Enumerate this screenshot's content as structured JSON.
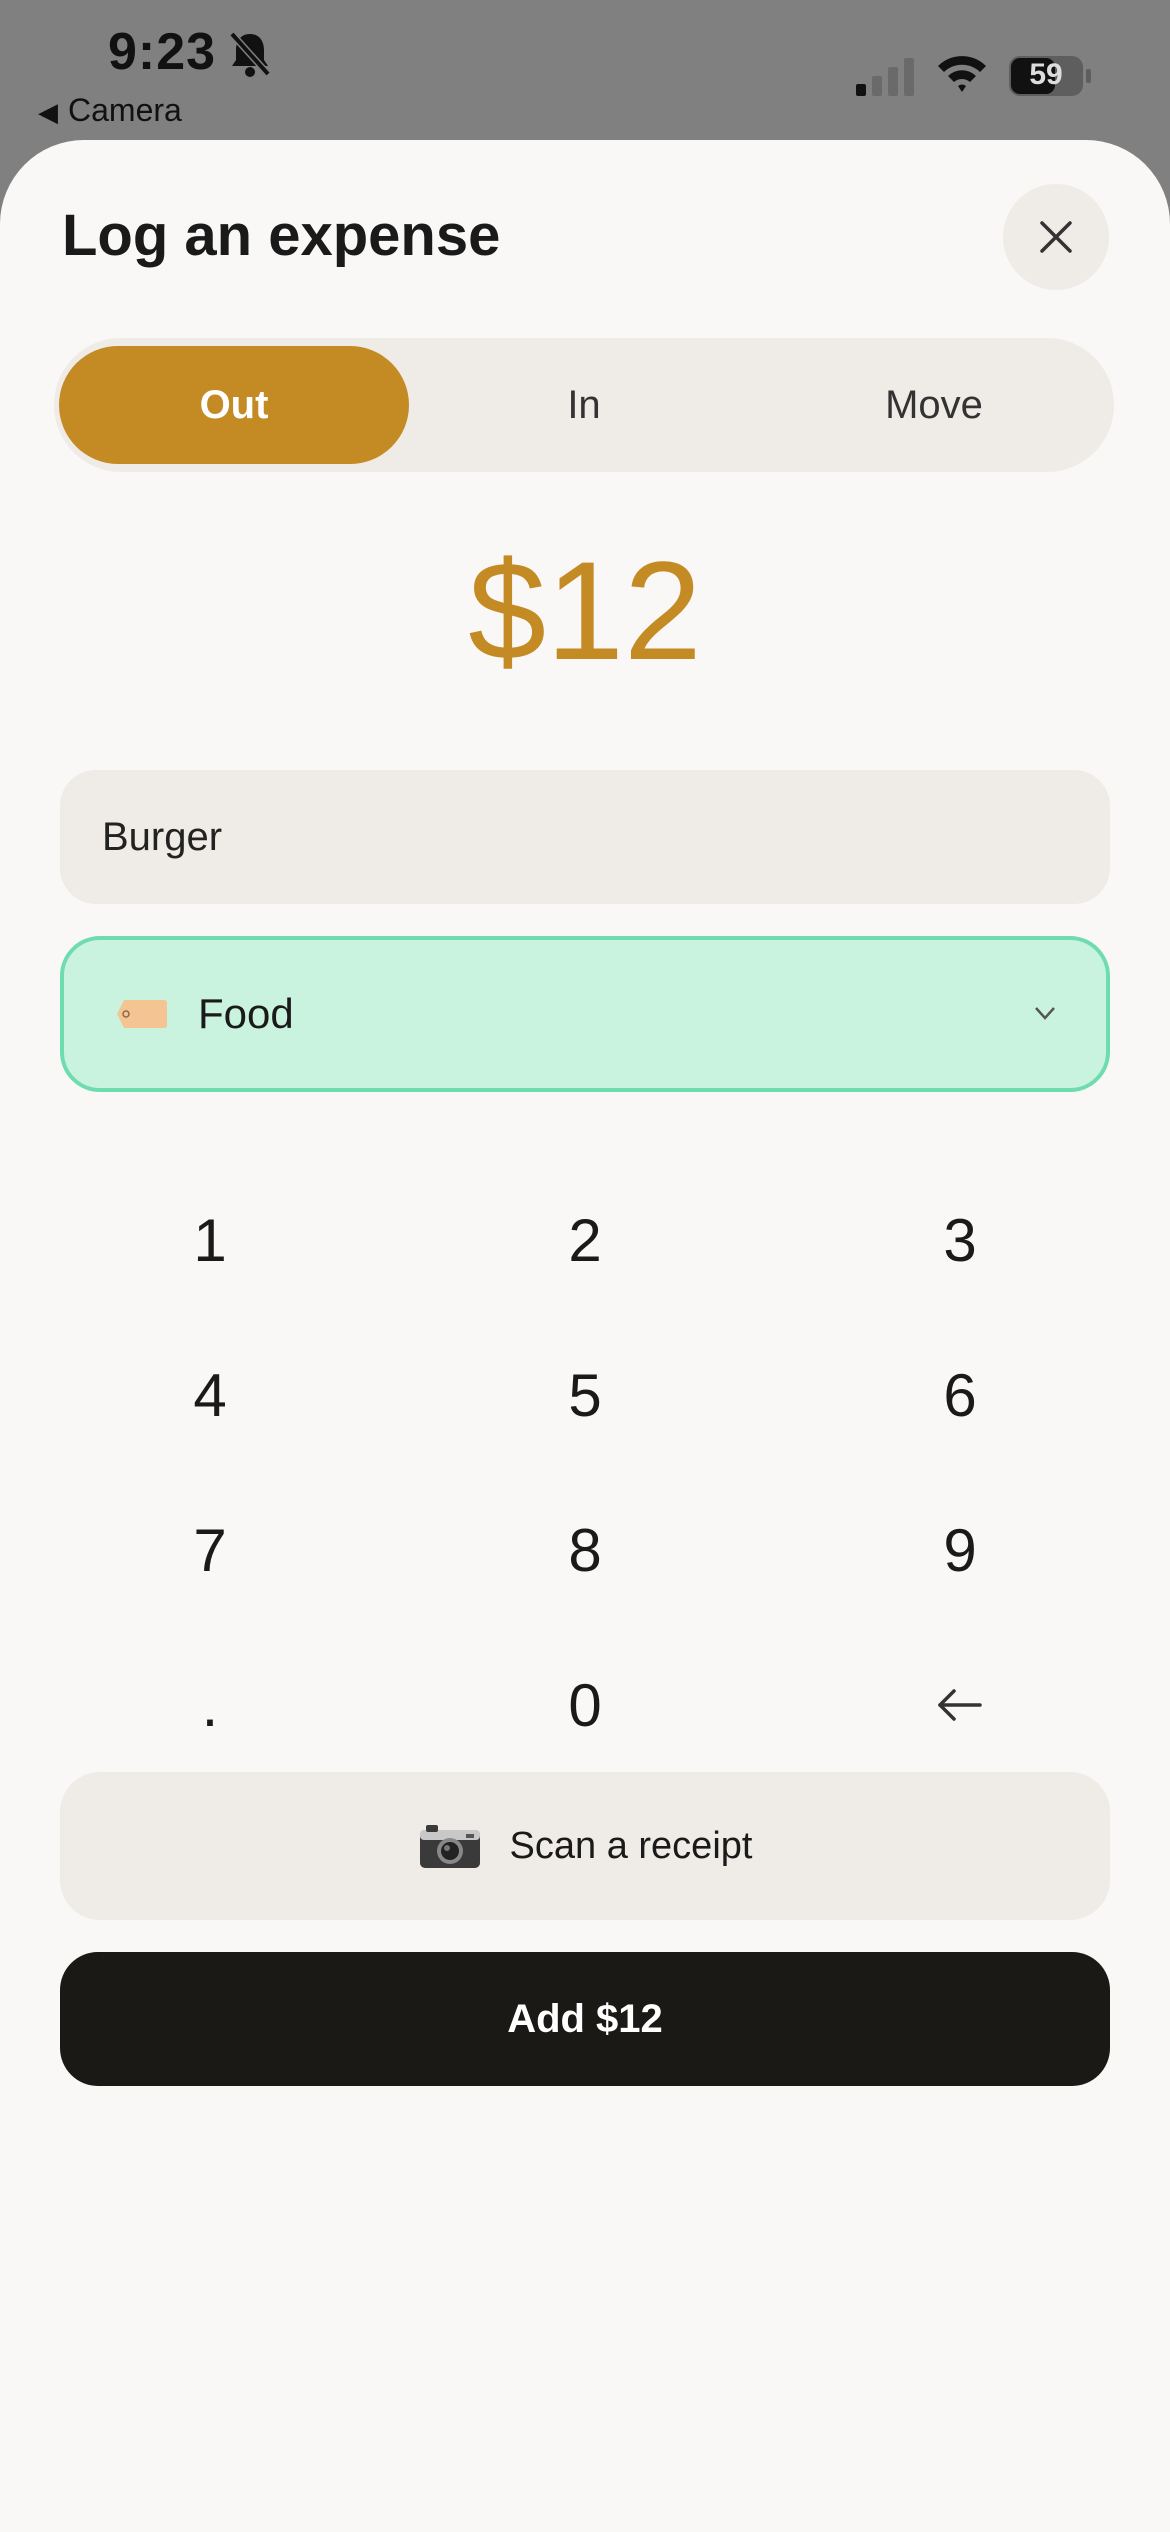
{
  "status_bar": {
    "time": "9:23",
    "back_label": "Camera",
    "battery_level": "59"
  },
  "sheet": {
    "title": "Log an expense",
    "close_icon": "close-icon"
  },
  "type_toggle": {
    "options": [
      "Out",
      "In",
      "Move"
    ],
    "selected": "Out"
  },
  "amount": "$12",
  "description": {
    "value": "Burger"
  },
  "category": {
    "icon": "tag-icon",
    "label": "Food"
  },
  "keypad": {
    "keys": [
      "1",
      "2",
      "3",
      "4",
      "5",
      "6",
      "7",
      "8",
      "9",
      ".",
      "0"
    ],
    "backspace_icon": "backspace-arrow-icon"
  },
  "scan_button": {
    "icon": "camera-icon",
    "label": "Scan a receipt"
  },
  "submit_button": {
    "label": "Add $12"
  },
  "colors": {
    "accent": "#c48a24",
    "category_bg": "#c9f3df",
    "category_border": "#6fdcb0",
    "primary_button": "#1a1915"
  }
}
